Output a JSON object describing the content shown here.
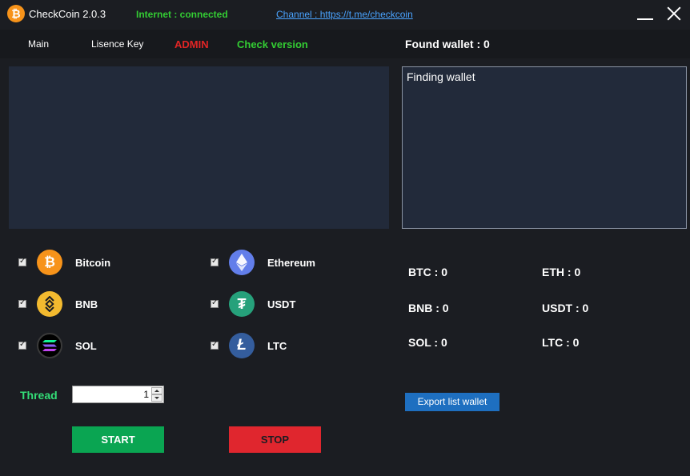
{
  "app": {
    "title": "CheckCoin 2.0.3",
    "logo_glyph": "₿"
  },
  "status": {
    "internet": "Internet : connected",
    "channel": "Channel : https://t.me/checkcoin"
  },
  "nav": {
    "main": "Main",
    "licence": "Lisence Key",
    "admin": "ADMIN",
    "check_version": "Check version"
  },
  "found_wallet": "Found wallet : 0",
  "log": {
    "text": "Finding wallet"
  },
  "coins": [
    {
      "label": "Bitcoin",
      "icon": "bitcoin-icon",
      "glyph": "₿",
      "checked": true
    },
    {
      "label": "Ethereum",
      "icon": "ethereum-icon",
      "glyph": "",
      "checked": true
    },
    {
      "label": "BNB",
      "icon": "bnb-icon",
      "glyph": "",
      "checked": true
    },
    {
      "label": "USDT",
      "icon": "usdt-icon",
      "glyph": "₮",
      "checked": true
    },
    {
      "label": "SOL",
      "icon": "solana-icon",
      "glyph": "",
      "checked": true
    },
    {
      "label": "LTC",
      "icon": "litecoin-icon",
      "glyph": "Ł",
      "checked": true
    }
  ],
  "stats": {
    "btc": "BTC : 0",
    "eth": "ETH : 0",
    "bnb": "BNB : 0",
    "usdt": "USDT : 0",
    "sol": "SOL : 0",
    "ltc": "LTC : 0"
  },
  "thread": {
    "label": "Thread",
    "value": "1"
  },
  "buttons": {
    "export": "Export list wallet",
    "start": "START",
    "stop": "STOP"
  },
  "colors": {
    "background": "#1b1d22",
    "panel": "#222a3a",
    "green": "#33cc33",
    "red": "#e02525",
    "blue": "#1e6fc0",
    "start": "#0aa552",
    "stop": "#e0262e"
  }
}
